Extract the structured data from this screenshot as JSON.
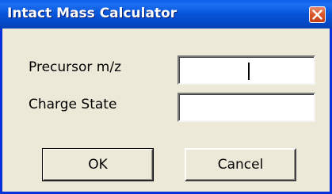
{
  "window": {
    "title": "Intact Mass Calculator"
  },
  "form": {
    "precursor_label": "Precursor m/z",
    "precursor_value": "",
    "charge_label": "Charge State",
    "charge_value": ""
  },
  "buttons": {
    "ok_label": "OK",
    "cancel_label": "Cancel"
  },
  "colors": {
    "titlebar": "#0754d8",
    "dialog_bg": "#ece9d8",
    "close_button": "#d9542a"
  },
  "icons": {
    "close": "close-icon"
  }
}
